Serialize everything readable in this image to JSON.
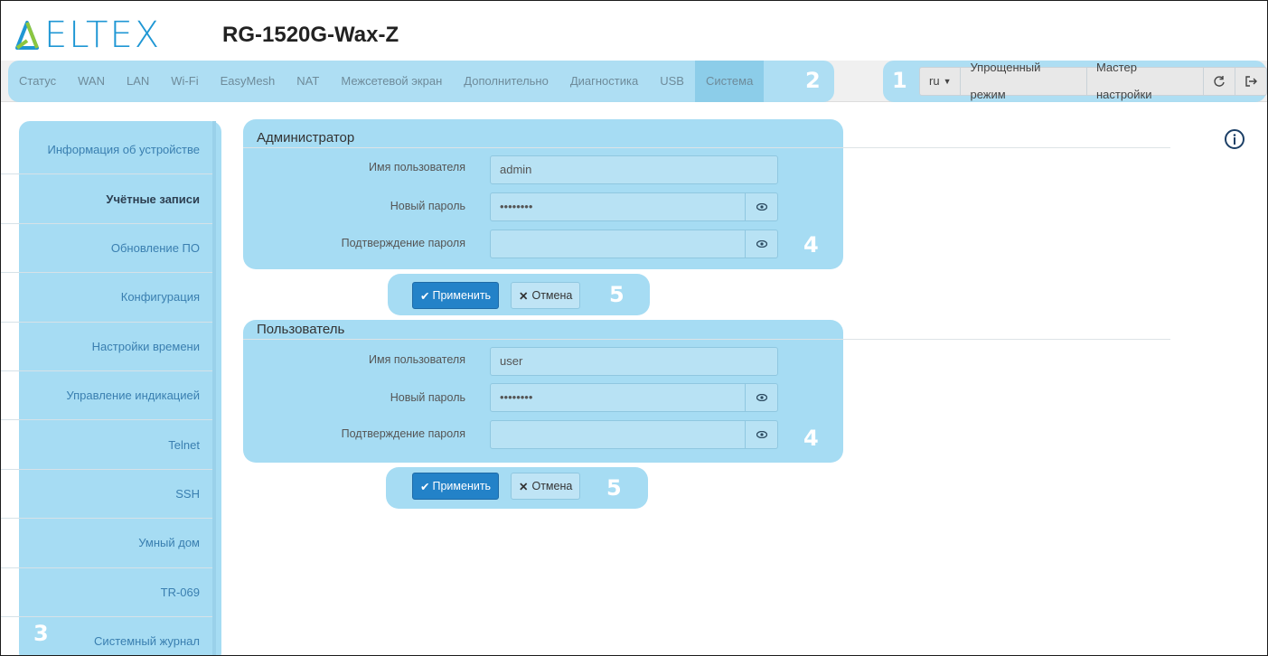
{
  "header": {
    "brand": "ELTEX",
    "model": "RG-1520G-Wax-Z"
  },
  "nav": {
    "items": [
      "Статус",
      "WAN",
      "LAN",
      "Wi-Fi",
      "EasyMesh",
      "NAT",
      "Межсетевой экран",
      "Дополнительно",
      "Диагностика",
      "USB",
      "Система"
    ],
    "active": "Система"
  },
  "toolbar": {
    "lang": "ru",
    "simple_mode": "Упрощенный режим",
    "wizard": "Мастер настройки"
  },
  "sidebar": {
    "items": [
      {
        "label": "Информация об устройстве"
      },
      {
        "label": "Учётные записи"
      },
      {
        "label": "Обновление ПО"
      },
      {
        "label": "Конфигурация"
      },
      {
        "label": "Настройки времени"
      },
      {
        "label": "Управление индикацией"
      },
      {
        "label": "Telnet"
      },
      {
        "label": "SSH"
      },
      {
        "label": "Умный дом"
      },
      {
        "label": "TR-069"
      },
      {
        "label": "Системный журнал"
      }
    ],
    "active": "Учётные записи"
  },
  "admin": {
    "title": "Администратор",
    "username_label": "Имя пользователя",
    "username_value": "admin",
    "password_label": "Новый пароль",
    "password_value": "••••••••",
    "confirm_label": "Подтверждение пароля",
    "confirm_value": ""
  },
  "user": {
    "title": "Пользователь",
    "username_label": "Имя пользователя",
    "username_value": "user",
    "password_label": "Новый пароль",
    "password_value": "••••••••",
    "confirm_label": "Подтверждение пароля",
    "confirm_value": ""
  },
  "buttons": {
    "apply": "Применить",
    "cancel": "Отмена"
  },
  "callouts": {
    "c1": "1",
    "c2": "2",
    "c3": "3",
    "c4": "4",
    "c5": "5"
  },
  "colors": {
    "accent": "#1f97d4",
    "highlight": "#a6dcf3",
    "primary_button": "#2382c8"
  }
}
